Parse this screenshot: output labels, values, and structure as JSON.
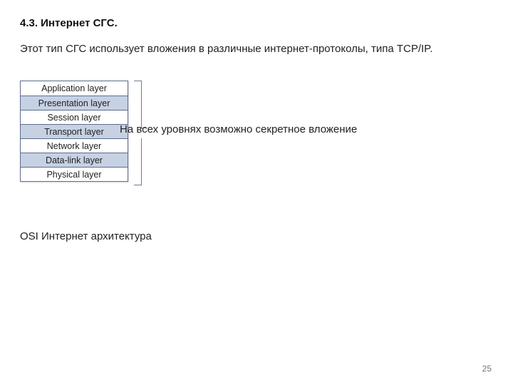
{
  "heading": "4.3. Интернет СГС.",
  "intro": "Этот тип СГС использует вложения в различные интернет-протоколы, типа TCP/IP.",
  "osi": {
    "layers": [
      {
        "label": "Application layer",
        "shaded": false
      },
      {
        "label": "Presentation layer",
        "shaded": true
      },
      {
        "label": "Session layer",
        "shaded": false
      },
      {
        "label": "Transport layer",
        "shaded": true
      },
      {
        "label": "Network layer",
        "shaded": false
      },
      {
        "label": "Data-link layer",
        "shaded": true
      },
      {
        "label": "Physical layer",
        "shaded": false
      }
    ],
    "annotation": "На всех уровнях возможно секретное вложение",
    "caption": "OSI Интернет архитектура"
  },
  "page_number": "25"
}
